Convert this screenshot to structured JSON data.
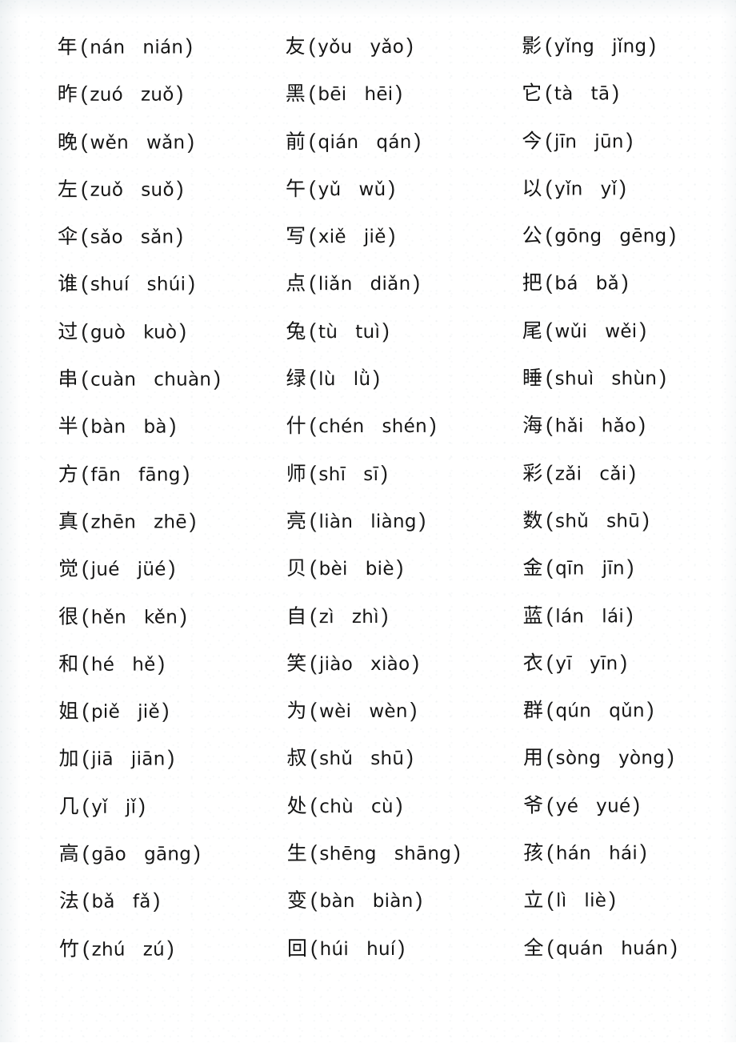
{
  "document": {
    "type": "pinyin-multiple-choice-worksheet",
    "columns": 3,
    "rows_per_column": 20,
    "total_entries": 60,
    "open_paren": "(",
    "close_paren": ")"
  },
  "columns": [
    {
      "name": "column-1",
      "entries": [
        {
          "hanzi": "年",
          "option_a": "nán",
          "option_b": "nián"
        },
        {
          "hanzi": "昨",
          "option_a": "zuó",
          "option_b": "zuǒ"
        },
        {
          "hanzi": "晚",
          "option_a": "wěn",
          "option_b": "wǎn"
        },
        {
          "hanzi": "左",
          "option_a": "zuǒ",
          "option_b": "suǒ"
        },
        {
          "hanzi": "伞",
          "option_a": "sǎo",
          "option_b": "sǎn"
        },
        {
          "hanzi": "谁",
          "option_a": "shuí",
          "option_b": "shúi"
        },
        {
          "hanzi": "过",
          "option_a": "guò",
          "option_b": "kuò"
        },
        {
          "hanzi": "串",
          "option_a": "cuàn",
          "option_b": "chuàn"
        },
        {
          "hanzi": "半",
          "option_a": "bàn",
          "option_b": "bà"
        },
        {
          "hanzi": "方",
          "option_a": "fān",
          "option_b": "fāng"
        },
        {
          "hanzi": "真",
          "option_a": "zhēn",
          "option_b": "zhē"
        },
        {
          "hanzi": "觉",
          "option_a": "jué",
          "option_b": "jüé"
        },
        {
          "hanzi": "很",
          "option_a": "hěn",
          "option_b": "kěn"
        },
        {
          "hanzi": "和",
          "option_a": "hé",
          "option_b": "hě"
        },
        {
          "hanzi": "姐",
          "option_a": "piě",
          "option_b": "jiě"
        },
        {
          "hanzi": "加",
          "option_a": "jiā",
          "option_b": "jiān"
        },
        {
          "hanzi": "几",
          "option_a": "yǐ",
          "option_b": "jǐ"
        },
        {
          "hanzi": "高",
          "option_a": "gāo",
          "option_b": "gāng"
        },
        {
          "hanzi": "法",
          "option_a": "bǎ",
          "option_b": "fǎ"
        },
        {
          "hanzi": "竹",
          "option_a": "zhú",
          "option_b": "zú"
        }
      ]
    },
    {
      "name": "column-2",
      "entries": [
        {
          "hanzi": "友",
          "option_a": "yǒu",
          "option_b": "yǎo"
        },
        {
          "hanzi": "黑",
          "option_a": "bēi",
          "option_b": "hēi"
        },
        {
          "hanzi": "前",
          "option_a": "qián",
          "option_b": "qán"
        },
        {
          "hanzi": "午",
          "option_a": "yǔ",
          "option_b": "wǔ"
        },
        {
          "hanzi": "写",
          "option_a": "xiě",
          "option_b": "jiě"
        },
        {
          "hanzi": "点",
          "option_a": "liǎn",
          "option_b": "diǎn"
        },
        {
          "hanzi": "兔",
          "option_a": "tù",
          "option_b": "tuì"
        },
        {
          "hanzi": "绿",
          "option_a": "lù",
          "option_b": "lǜ"
        },
        {
          "hanzi": "什",
          "option_a": "chén",
          "option_b": "shén"
        },
        {
          "hanzi": "师",
          "option_a": "shī",
          "option_b": "sī"
        },
        {
          "hanzi": "亮",
          "option_a": "liàn",
          "option_b": "liàng"
        },
        {
          "hanzi": "贝",
          "option_a": "bèi",
          "option_b": "biè"
        },
        {
          "hanzi": "自",
          "option_a": "zì",
          "option_b": "zhì"
        },
        {
          "hanzi": "笑",
          "option_a": "jiào",
          "option_b": "xiào"
        },
        {
          "hanzi": "为",
          "option_a": "wèi",
          "option_b": "wèn"
        },
        {
          "hanzi": "叔",
          "option_a": "shǔ",
          "option_b": "shū"
        },
        {
          "hanzi": "处",
          "option_a": "chù",
          "option_b": "cù"
        },
        {
          "hanzi": "生",
          "option_a": "shēng",
          "option_b": "shāng"
        },
        {
          "hanzi": "变",
          "option_a": "bàn",
          "option_b": "biàn"
        },
        {
          "hanzi": "回",
          "option_a": "húi",
          "option_b": "huí"
        }
      ]
    },
    {
      "name": "column-3",
      "entries": [
        {
          "hanzi": "影",
          "option_a": "yǐng",
          "option_b": "jǐng"
        },
        {
          "hanzi": "它",
          "option_a": "tà",
          "option_b": "tā"
        },
        {
          "hanzi": "今",
          "option_a": "jīn",
          "option_b": "jūn"
        },
        {
          "hanzi": "以",
          "option_a": "yǐn",
          "option_b": "yǐ"
        },
        {
          "hanzi": "公",
          "option_a": "gōng",
          "option_b": "gēng"
        },
        {
          "hanzi": "把",
          "option_a": "bá",
          "option_b": "bǎ"
        },
        {
          "hanzi": "尾",
          "option_a": "wǔi",
          "option_b": "wěi"
        },
        {
          "hanzi": "睡",
          "option_a": "shuì",
          "option_b": "shùn"
        },
        {
          "hanzi": "海",
          "option_a": "hǎi",
          "option_b": "hǎo"
        },
        {
          "hanzi": "彩",
          "option_a": "zǎi",
          "option_b": "cǎi"
        },
        {
          "hanzi": "数",
          "option_a": "shǔ",
          "option_b": "shū"
        },
        {
          "hanzi": "金",
          "option_a": "qīn",
          "option_b": "jīn"
        },
        {
          "hanzi": "蓝",
          "option_a": "lán",
          "option_b": "lái"
        },
        {
          "hanzi": "衣",
          "option_a": "yī",
          "option_b": "yīn"
        },
        {
          "hanzi": "群",
          "option_a": "qún",
          "option_b": "qǔn"
        },
        {
          "hanzi": "用",
          "option_a": "sòng",
          "option_b": "yòng"
        },
        {
          "hanzi": "爷",
          "option_a": "yé",
          "option_b": "yué"
        },
        {
          "hanzi": "孩",
          "option_a": "hán",
          "option_b": "hái"
        },
        {
          "hanzi": "立",
          "option_a": "lì",
          "option_b": "liè"
        },
        {
          "hanzi": "全",
          "option_a": "quán",
          "option_b": "huán"
        }
      ]
    }
  ]
}
